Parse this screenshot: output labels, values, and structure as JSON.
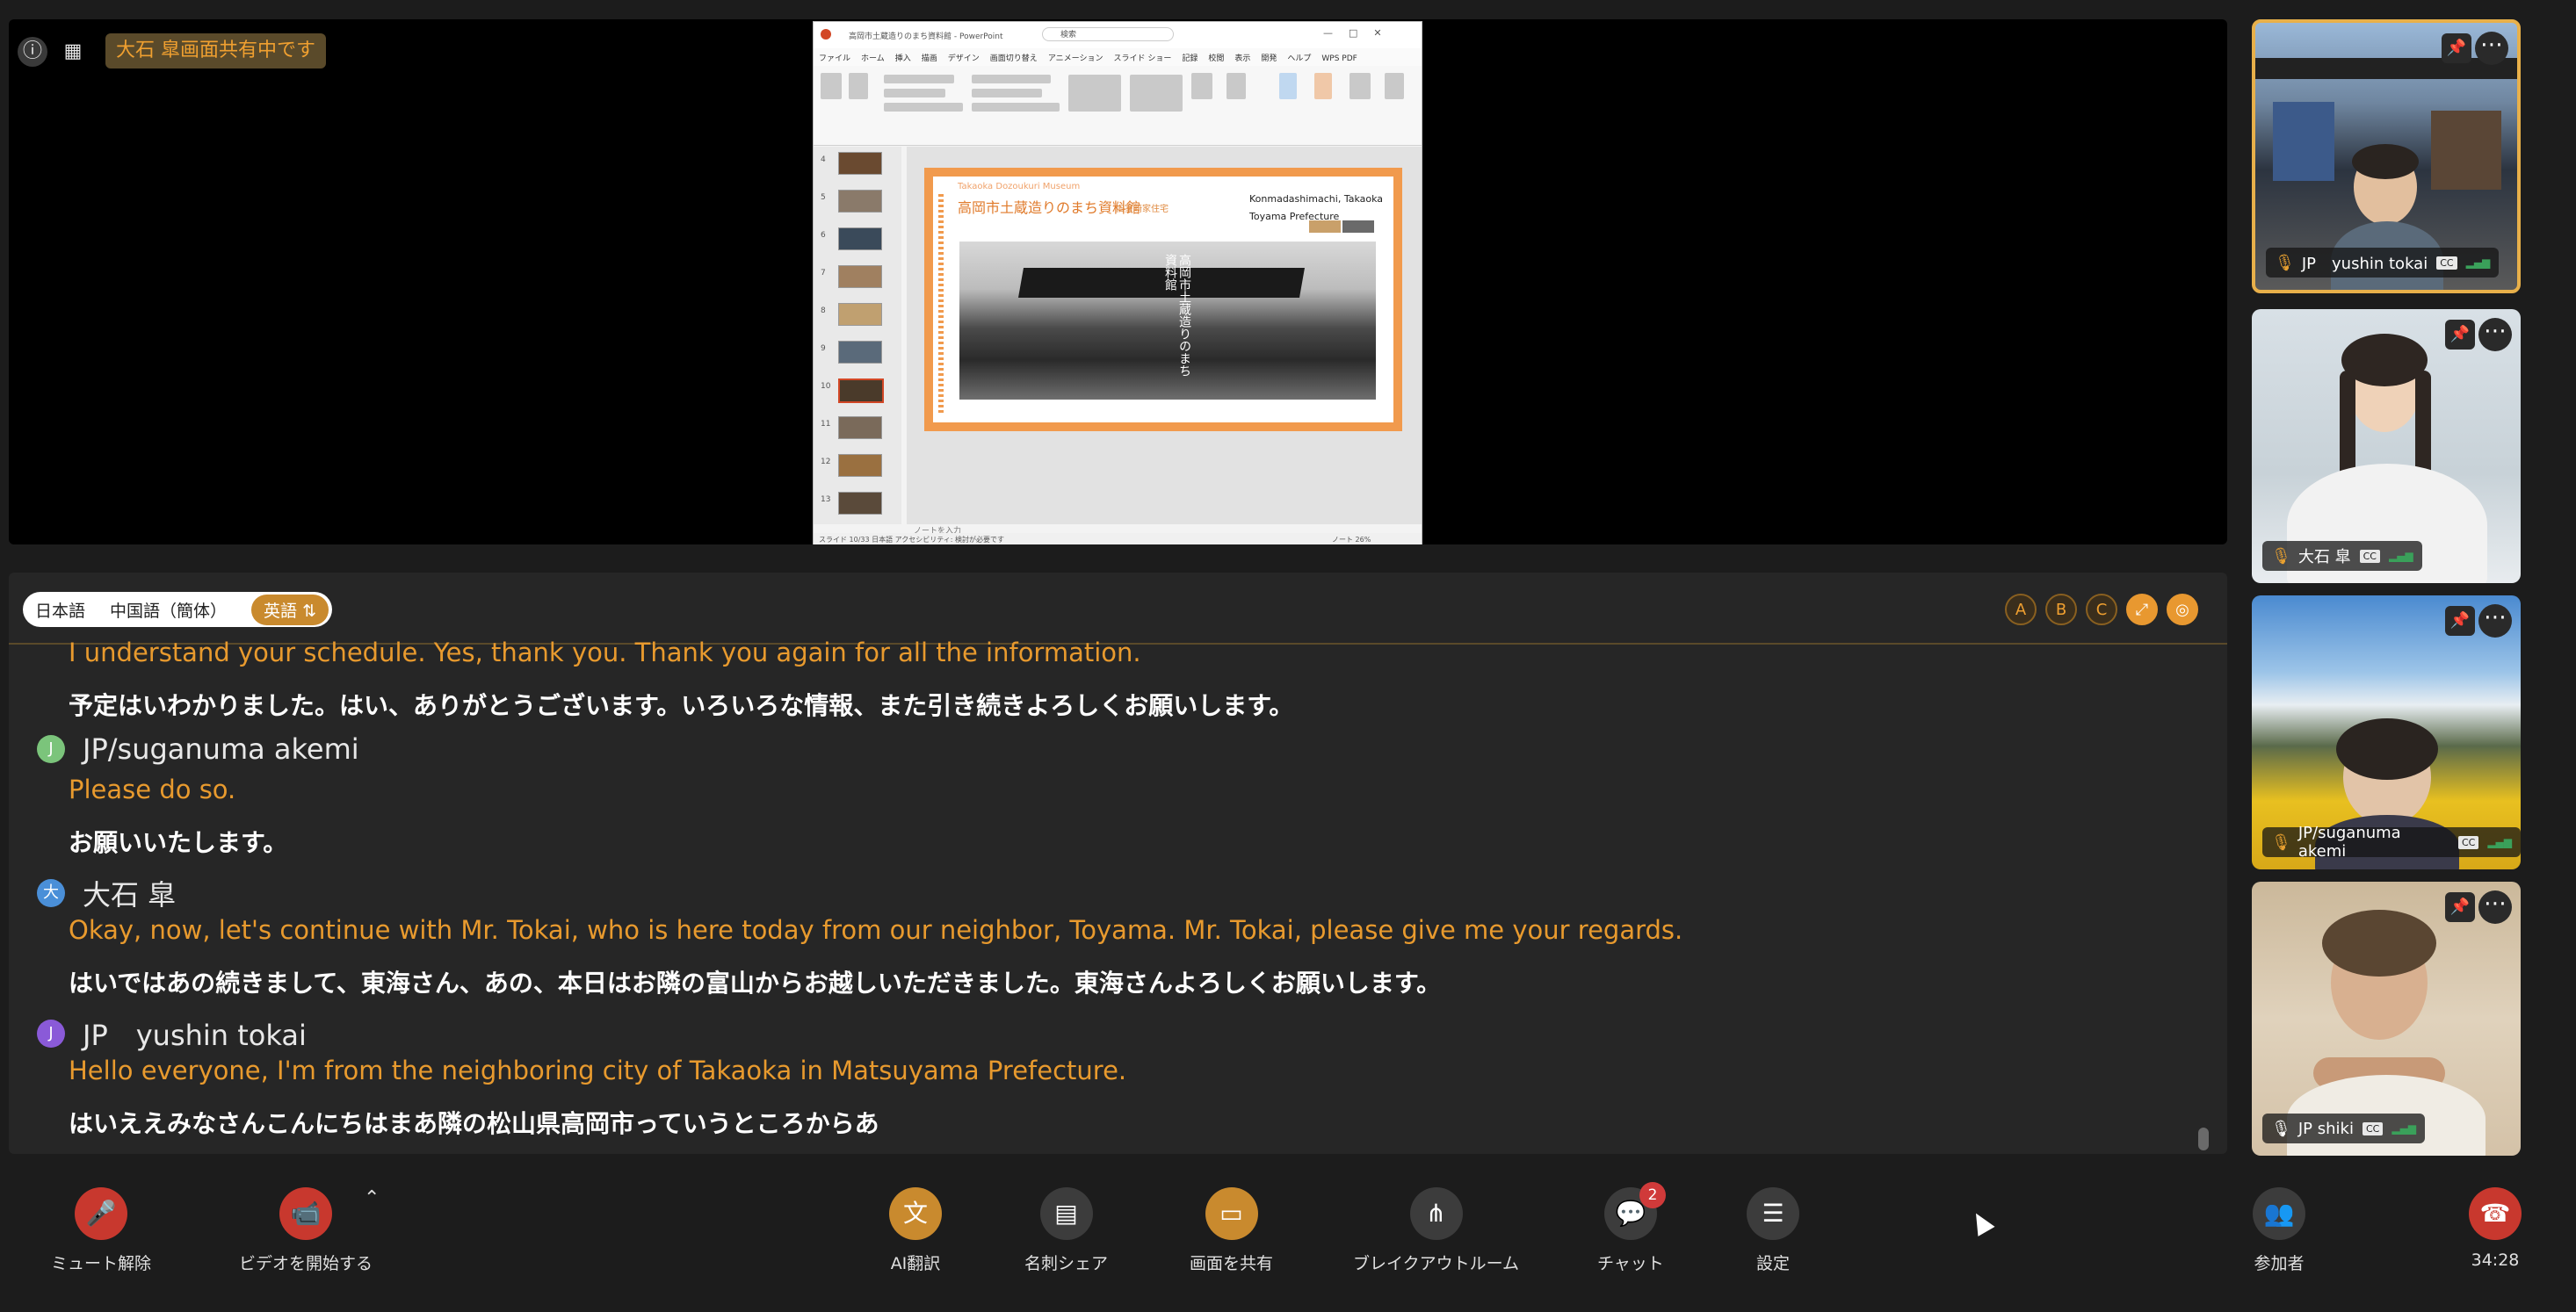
{
  "screen": {
    "share_badge": "大石 皐画面共有中です",
    "ppt": {
      "window_title": "高岡市土蔵造りのまち資料館 - PowerPoint",
      "search_placeholder": "検索",
      "menu": [
        "ファイル",
        "ホーム",
        "挿入",
        "描画",
        "デザイン",
        "画面切り替え",
        "アニメーション",
        "スライド ショー",
        "記録",
        "校閲",
        "表示",
        "開発",
        "ヘルプ",
        "WPS PDF"
      ],
      "thumb_numbers": [
        "4",
        "5",
        "6",
        "7",
        "8",
        "9",
        "10",
        "11",
        "12",
        "13"
      ],
      "notes_placeholder": "ノートを入力",
      "status_left": "スライド 10/33   日本語   アクセシビリティ: 検討が必要です",
      "status_right": "ノート   26%",
      "slide": {
        "title_en": "Takaoka Dozoukuri Museum",
        "title_ja": "高岡市土蔵造りのまち資料館",
        "subtitle": "旧室崎家住宅",
        "address_line1": "Konmadashimachi, Takaoka",
        "address_line2": "Toyama Prefecture",
        "sign_text": "高岡市土蔵造りのまち資料館"
      }
    }
  },
  "captions": {
    "tabs": [
      {
        "label": "日本語",
        "active": false
      },
      {
        "label": "中国語（簡体）",
        "active": false
      },
      {
        "label": "英語 ⇅",
        "active": true
      }
    ],
    "options": [
      "A",
      "B",
      "C",
      "⤢",
      "◎"
    ],
    "entries": [
      {
        "speaker": "",
        "initial": "",
        "color": "#6a6a6a",
        "en": "I understand your schedule. Yes, thank you. Thank you again for all the information.",
        "ja": "予定はいわかりました。はい、ありがとうございます。いろいろな情報、また引き続きよろしくお願いします。"
      },
      {
        "speaker": "JP/suganuma akemi",
        "initial": "J",
        "color": "#7bc47b",
        "en": "Please do so.",
        "ja": "お願いいたします。"
      },
      {
        "speaker": "大石 皐",
        "initial": "大",
        "color": "#4a8fd8",
        "en": "Okay, now, let's continue with Mr. Tokai, who is here today from our neighbor, Toyama. Mr. Tokai, please give me your regards.",
        "ja": "はいではあの続きまして、東海さん、あの、本日はお隣の富山からお越しいただきました。東海さんよろしくお願いします。"
      },
      {
        "speaker": "JP　yushin tokai",
        "initial": "J",
        "color": "#8a5ad8",
        "en": "Hello everyone, I'm from the neighboring city of Takaoka in Matsuyama Prefecture.",
        "ja": "はいええみなさんこんにちはまあ隣の松山県高岡市っていうところからあ"
      }
    ]
  },
  "participants": [
    {
      "name": "JP　yushin tokai",
      "active_speaker": true
    },
    {
      "name": "大石 皐",
      "active_speaker": false
    },
    {
      "name": "JP/suganuma akemi",
      "active_speaker": false
    },
    {
      "name": "JP shiki",
      "active_speaker": false
    }
  ],
  "toolbar": {
    "unmute": "ミュート解除",
    "start_video": "ビデオを開始する",
    "ai_translate": "AI翻訳",
    "business_card": "名刺シェア",
    "share_screen": "画面を共有",
    "breakout": "ブレイクアウトルーム",
    "chat": "チャット",
    "chat_badge": "2",
    "settings": "設定",
    "participants": "参加者",
    "timer": "34:28"
  },
  "colors": {
    "accent": "#e89a2e",
    "danger": "#c8382e",
    "panel": "#262626",
    "background": "#1c1c1c"
  }
}
